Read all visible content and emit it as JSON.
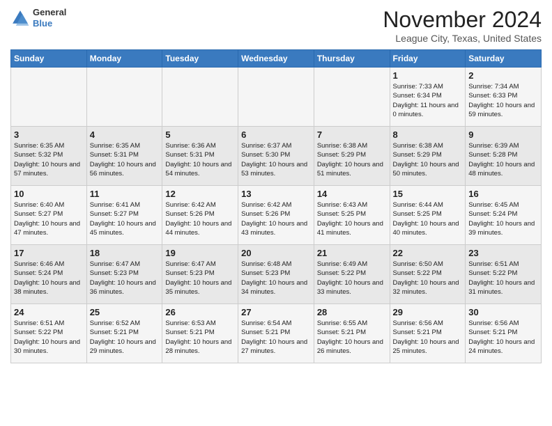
{
  "header": {
    "logo_line1": "General",
    "logo_line2": "Blue",
    "month": "November 2024",
    "location": "League City, Texas, United States"
  },
  "weekdays": [
    "Sunday",
    "Monday",
    "Tuesday",
    "Wednesday",
    "Thursday",
    "Friday",
    "Saturday"
  ],
  "weeks": [
    [
      {
        "day": "",
        "info": ""
      },
      {
        "day": "",
        "info": ""
      },
      {
        "day": "",
        "info": ""
      },
      {
        "day": "",
        "info": ""
      },
      {
        "day": "",
        "info": ""
      },
      {
        "day": "1",
        "info": "Sunrise: 7:33 AM\nSunset: 6:34 PM\nDaylight: 11 hours and 0 minutes."
      },
      {
        "day": "2",
        "info": "Sunrise: 7:34 AM\nSunset: 6:33 PM\nDaylight: 10 hours and 59 minutes."
      }
    ],
    [
      {
        "day": "3",
        "info": "Sunrise: 6:35 AM\nSunset: 5:32 PM\nDaylight: 10 hours and 57 minutes."
      },
      {
        "day": "4",
        "info": "Sunrise: 6:35 AM\nSunset: 5:31 PM\nDaylight: 10 hours and 56 minutes."
      },
      {
        "day": "5",
        "info": "Sunrise: 6:36 AM\nSunset: 5:31 PM\nDaylight: 10 hours and 54 minutes."
      },
      {
        "day": "6",
        "info": "Sunrise: 6:37 AM\nSunset: 5:30 PM\nDaylight: 10 hours and 53 minutes."
      },
      {
        "day": "7",
        "info": "Sunrise: 6:38 AM\nSunset: 5:29 PM\nDaylight: 10 hours and 51 minutes."
      },
      {
        "day": "8",
        "info": "Sunrise: 6:38 AM\nSunset: 5:29 PM\nDaylight: 10 hours and 50 minutes."
      },
      {
        "day": "9",
        "info": "Sunrise: 6:39 AM\nSunset: 5:28 PM\nDaylight: 10 hours and 48 minutes."
      }
    ],
    [
      {
        "day": "10",
        "info": "Sunrise: 6:40 AM\nSunset: 5:27 PM\nDaylight: 10 hours and 47 minutes."
      },
      {
        "day": "11",
        "info": "Sunrise: 6:41 AM\nSunset: 5:27 PM\nDaylight: 10 hours and 45 minutes."
      },
      {
        "day": "12",
        "info": "Sunrise: 6:42 AM\nSunset: 5:26 PM\nDaylight: 10 hours and 44 minutes."
      },
      {
        "day": "13",
        "info": "Sunrise: 6:42 AM\nSunset: 5:26 PM\nDaylight: 10 hours and 43 minutes."
      },
      {
        "day": "14",
        "info": "Sunrise: 6:43 AM\nSunset: 5:25 PM\nDaylight: 10 hours and 41 minutes."
      },
      {
        "day": "15",
        "info": "Sunrise: 6:44 AM\nSunset: 5:25 PM\nDaylight: 10 hours and 40 minutes."
      },
      {
        "day": "16",
        "info": "Sunrise: 6:45 AM\nSunset: 5:24 PM\nDaylight: 10 hours and 39 minutes."
      }
    ],
    [
      {
        "day": "17",
        "info": "Sunrise: 6:46 AM\nSunset: 5:24 PM\nDaylight: 10 hours and 38 minutes."
      },
      {
        "day": "18",
        "info": "Sunrise: 6:47 AM\nSunset: 5:23 PM\nDaylight: 10 hours and 36 minutes."
      },
      {
        "day": "19",
        "info": "Sunrise: 6:47 AM\nSunset: 5:23 PM\nDaylight: 10 hours and 35 minutes."
      },
      {
        "day": "20",
        "info": "Sunrise: 6:48 AM\nSunset: 5:23 PM\nDaylight: 10 hours and 34 minutes."
      },
      {
        "day": "21",
        "info": "Sunrise: 6:49 AM\nSunset: 5:22 PM\nDaylight: 10 hours and 33 minutes."
      },
      {
        "day": "22",
        "info": "Sunrise: 6:50 AM\nSunset: 5:22 PM\nDaylight: 10 hours and 32 minutes."
      },
      {
        "day": "23",
        "info": "Sunrise: 6:51 AM\nSunset: 5:22 PM\nDaylight: 10 hours and 31 minutes."
      }
    ],
    [
      {
        "day": "24",
        "info": "Sunrise: 6:51 AM\nSunset: 5:22 PM\nDaylight: 10 hours and 30 minutes."
      },
      {
        "day": "25",
        "info": "Sunrise: 6:52 AM\nSunset: 5:21 PM\nDaylight: 10 hours and 29 minutes."
      },
      {
        "day": "26",
        "info": "Sunrise: 6:53 AM\nSunset: 5:21 PM\nDaylight: 10 hours and 28 minutes."
      },
      {
        "day": "27",
        "info": "Sunrise: 6:54 AM\nSunset: 5:21 PM\nDaylight: 10 hours and 27 minutes."
      },
      {
        "day": "28",
        "info": "Sunrise: 6:55 AM\nSunset: 5:21 PM\nDaylight: 10 hours and 26 minutes."
      },
      {
        "day": "29",
        "info": "Sunrise: 6:56 AM\nSunset: 5:21 PM\nDaylight: 10 hours and 25 minutes."
      },
      {
        "day": "30",
        "info": "Sunrise: 6:56 AM\nSunset: 5:21 PM\nDaylight: 10 hours and 24 minutes."
      }
    ]
  ]
}
